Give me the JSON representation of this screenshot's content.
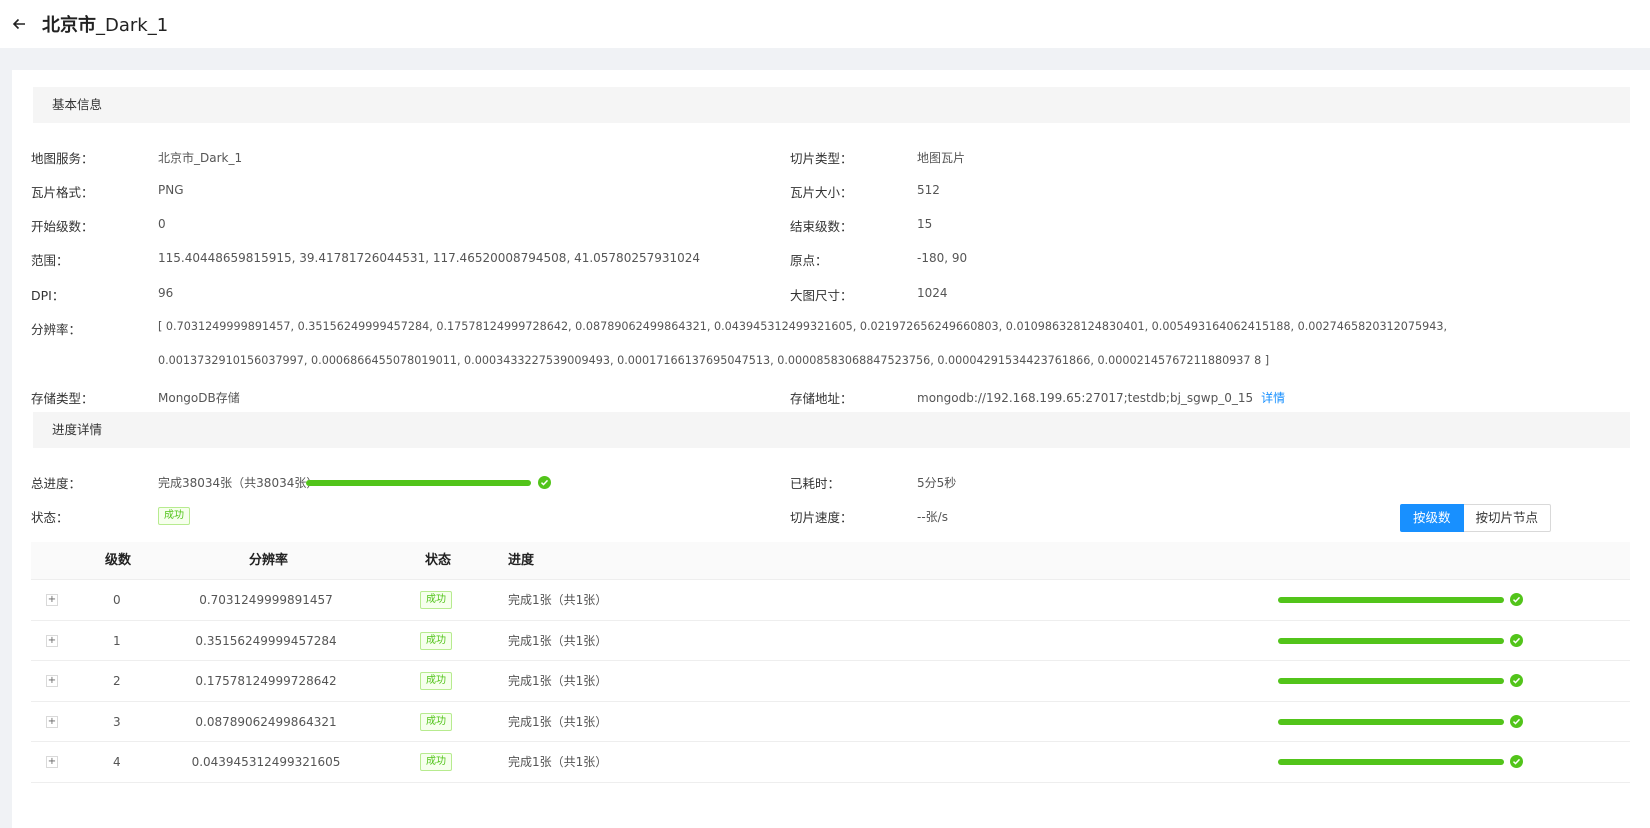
{
  "header": {
    "title_main": "北京市",
    "title_suffix": "_Dark_1"
  },
  "basic": {
    "section_title": "基本信息",
    "fields": {
      "map_service": {
        "label": "地图服务：",
        "value": "北京市_Dark_1"
      },
      "tile_type": {
        "label": "切片类型：",
        "value": "地图瓦片"
      },
      "tile_format": {
        "label": "瓦片格式：",
        "value": "PNG"
      },
      "tile_size": {
        "label": "瓦片大小：",
        "value": "512"
      },
      "start_level": {
        "label": "开始级数：",
        "value": "0"
      },
      "end_level": {
        "label": "结束级数：",
        "value": "15"
      },
      "extent": {
        "label": "范围：",
        "value": "115.40448659815915, 39.41781726044531, 117.46520008794508, 41.05780257931024"
      },
      "origin": {
        "label": "原点：",
        "value": "-180, 90"
      },
      "dpi": {
        "label": "DPI：",
        "value": "96"
      },
      "big_image_size": {
        "label": "大图尺寸：",
        "value": "1024"
      },
      "resolution": {
        "label": "分辨率：",
        "line1": "[ 0.7031249999891457, 0.35156249999457284, 0.17578124999728642, 0.08789062499864321, 0.043945312499321605, 0.021972656249660803, 0.010986328124830401, 0.005493164062415188, 0.0027465820312075943,",
        "line2": "0.0013732910156037997, 0.0006866455078019011, 0.0003433227539009493, 0.00017166137695047513, 0.00008583068847523756, 0.00004291534423761866, 0.00002145767211880937 8 ]"
      },
      "storage_type": {
        "label": "存储类型：",
        "value": "MongoDB存储"
      },
      "storage_addr": {
        "label": "存储地址：",
        "value": "mongodb://192.168.199.65:27017;testdb;bj_sgwp_0_15",
        "link": "详情"
      }
    }
  },
  "progress": {
    "section_title": "进度详情",
    "total_label": "总进度：",
    "total_text": "完成38034张（共38034张）",
    "total_fraction": 1.0,
    "elapsed_label": "已耗时：",
    "elapsed_value": "5分5秒",
    "status_label": "状态：",
    "status_value": "成功",
    "speed_label": "切片速度：",
    "speed_value": "--张/s",
    "toggle": {
      "by_level": "按级数",
      "by_node": "按切片节点"
    }
  },
  "table": {
    "columns": {
      "level": "级数",
      "resolution": "分辨率",
      "status": "状态",
      "progress": "进度"
    },
    "rows": [
      {
        "expand": "+",
        "level": "0",
        "resolution": "0.7031249999891457",
        "status": "成功",
        "progress": "完成1张（共1张）",
        "fraction": 1.0
      },
      {
        "expand": "+",
        "level": "1",
        "resolution": "0.35156249999457284",
        "status": "成功",
        "progress": "完成1张（共1张）",
        "fraction": 1.0
      },
      {
        "expand": "+",
        "level": "2",
        "resolution": "0.17578124999728642",
        "status": "成功",
        "progress": "完成1张（共1张）",
        "fraction": 1.0
      },
      {
        "expand": "+",
        "level": "3",
        "resolution": "0.08789062499864321",
        "status": "成功",
        "progress": "完成1张（共1张）",
        "fraction": 1.0
      },
      {
        "expand": "+",
        "level": "4",
        "resolution": "0.043945312499321605",
        "status": "成功",
        "progress": "完成1张（共1张）",
        "fraction": 1.0
      }
    ]
  },
  "colors": {
    "success": "#52c41a",
    "primary": "#1890ff"
  }
}
